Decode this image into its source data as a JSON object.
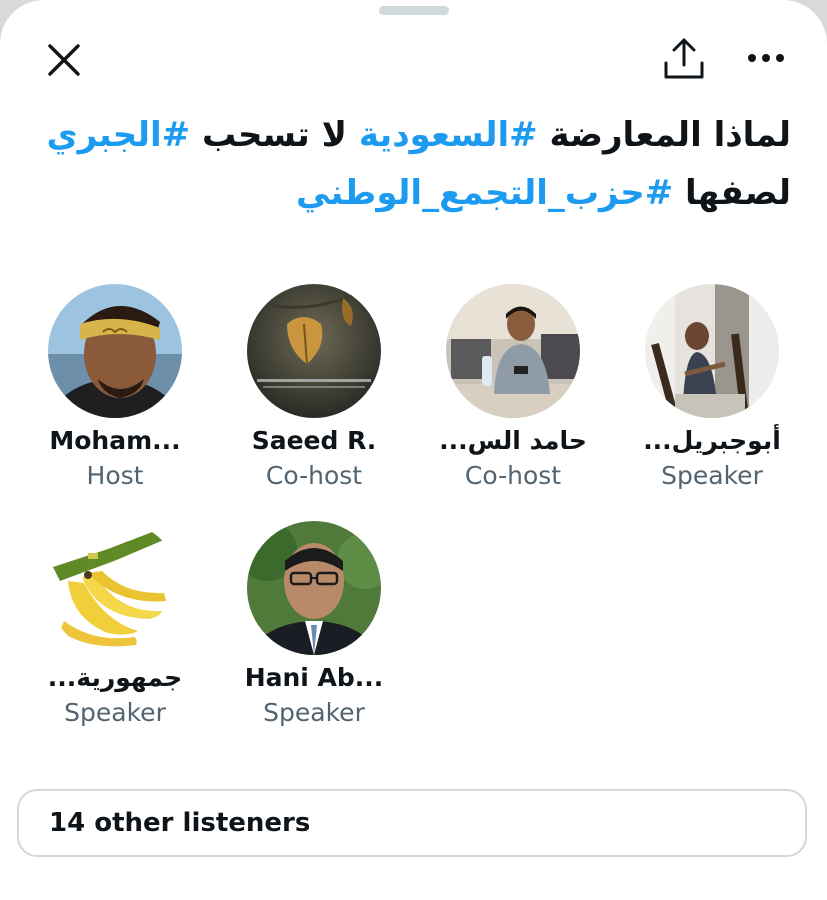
{
  "title": {
    "line1": [
      {
        "text": "لماذا المعارضة ",
        "tag": false
      },
      {
        "text": "#السعودية",
        "tag": true
      },
      {
        "text": " لا تسحب ",
        "tag": false
      },
      {
        "text": "#الجبري",
        "tag": true
      }
    ],
    "line2": [
      {
        "text": "لصفها ",
        "tag": false
      },
      {
        "text": "#حزب_التجمع_الوطني",
        "tag": true
      }
    ]
  },
  "icons": {
    "close": "close-icon",
    "share": "share-icon",
    "more": "more-icon"
  },
  "participants": [
    {
      "name": "Moham...",
      "role": "Host"
    },
    {
      "name": "Saeed R.",
      "role": "Co-host"
    },
    {
      "name": "حامد الس...",
      "role": "Co-host"
    },
    {
      "name": "أبوجبريل...",
      "role": "Speaker"
    },
    {
      "name": "جمهورية...",
      "role": "Speaker"
    },
    {
      "name": "Hani Ab...",
      "role": "Speaker"
    }
  ],
  "listeners": {
    "label": "14 other listeners"
  },
  "colors": {
    "hashtag": "#1d9bf0",
    "text": "#0f1419",
    "secondary": "#536471",
    "border": "#cfd9de"
  }
}
